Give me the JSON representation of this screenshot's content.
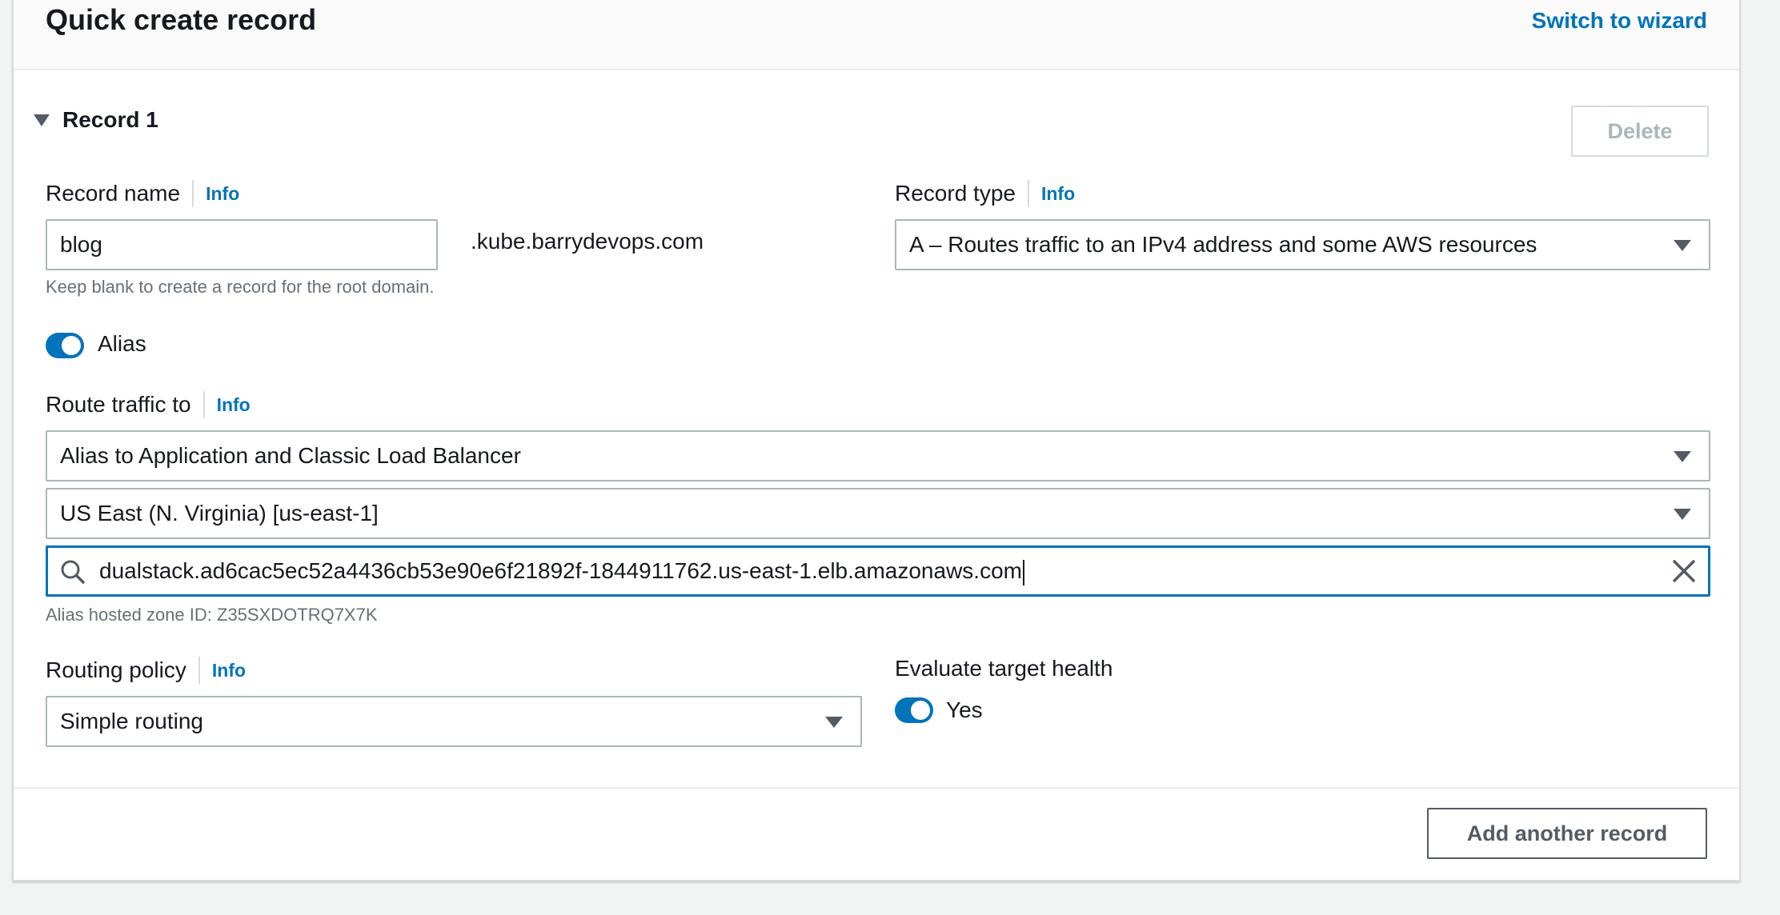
{
  "header": {
    "title": "Quick create record",
    "switch_link": "Switch to wizard"
  },
  "record": {
    "section_title": "Record 1",
    "delete_label": "Delete",
    "record_name": {
      "label": "Record name",
      "info": "Info",
      "value": "blog",
      "suffix": ".kube.barrydevops.com",
      "hint": "Keep blank to create a record for the root domain."
    },
    "record_type": {
      "label": "Record type",
      "info": "Info",
      "value": "A – Routes traffic to an IPv4 address and some AWS resources"
    },
    "alias": {
      "label": "Alias",
      "enabled": true
    },
    "route_traffic": {
      "label": "Route traffic to",
      "info": "Info",
      "endpoint_type": "Alias to Application and Classic Load Balancer",
      "region": "US East (N. Virginia) [us-east-1]",
      "search_value": "dualstack.ad6cac5ec52a4436cb53e90e6f21892f-1844911762.us-east-1.elb.amazonaws.com",
      "hosted_zone_hint": "Alias hosted zone ID: Z35SXDOTRQ7X7K"
    },
    "routing_policy": {
      "label": "Routing policy",
      "info": "Info",
      "value": "Simple routing"
    },
    "evaluate_health": {
      "label": "Evaluate target health",
      "toggle_label": "Yes",
      "enabled": true
    }
  },
  "footer": {
    "add_label": "Add another record"
  },
  "colors": {
    "accent": "#0073bb",
    "border": "#aab7b8",
    "background": "#f2f3f3"
  },
  "icons": [
    "chevron-down-icon",
    "caret-down-icon",
    "search-icon",
    "clear-icon"
  ]
}
